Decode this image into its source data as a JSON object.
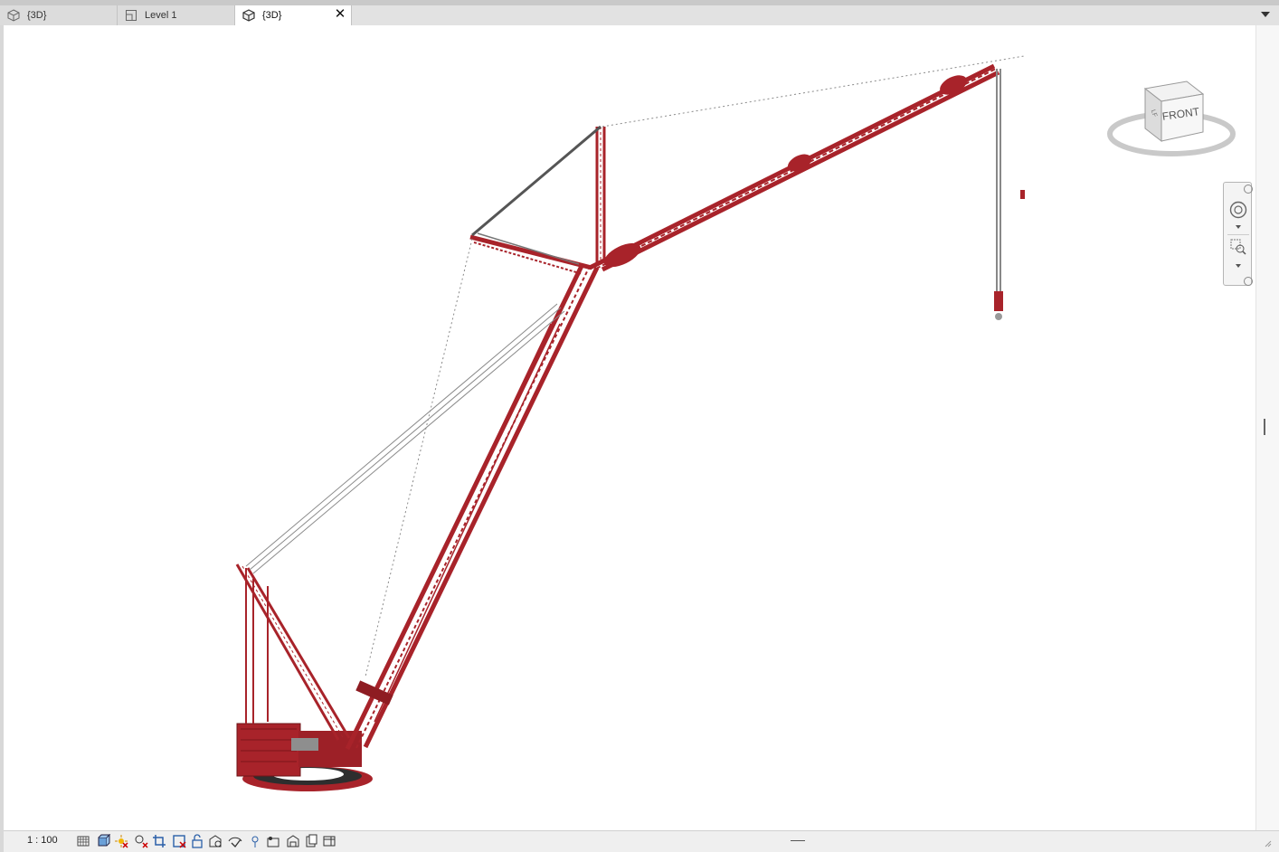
{
  "tabs": [
    {
      "label": "{3D}",
      "icon": "3d-view-icon",
      "active": false
    },
    {
      "label": "Level 1",
      "icon": "floor-plan-icon",
      "active": false
    },
    {
      "label": "{3D}",
      "icon": "3d-view-icon",
      "active": true
    }
  ],
  "tab_close_glyph": "✕",
  "viewcube": {
    "face_label": "FRONT",
    "side_label": "LF"
  },
  "status": {
    "scale": "1 : 100",
    "controls": [
      "detail-level-icon",
      "visual-style-icon",
      "sun-path-icon",
      "shadows-icon",
      "crop-view-icon",
      "show-crop-region-icon",
      "unlock-3d-view-icon",
      "temporary-hide-isolate-icon",
      "reveal-hidden-elements-icon",
      "worksharing-display-icon",
      "analytical-model-icon",
      "highlight-displacement-icon",
      "render-icon",
      "constraints-icon",
      "temp-view-properties-icon"
    ]
  },
  "model": {
    "color": "#a8232a",
    "cable_color": "#8a8a8a",
    "ring_color": "#2e2e2e"
  }
}
